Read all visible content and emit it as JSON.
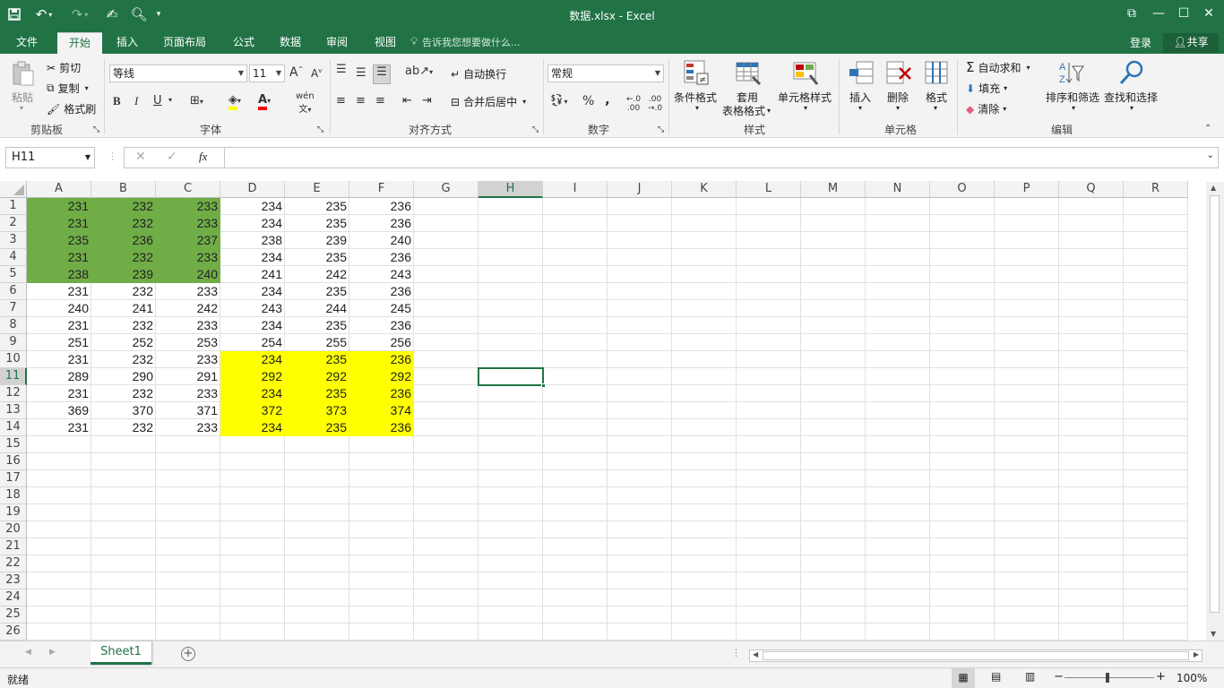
{
  "window": {
    "title": "数据.xlsx - Excel",
    "accent": "#217346"
  },
  "tabs": [
    {
      "label": "文件",
      "active": false
    },
    {
      "label": "开始",
      "active": true
    },
    {
      "label": "插入",
      "active": false
    },
    {
      "label": "页面布局",
      "active": false
    },
    {
      "label": "公式",
      "active": false
    },
    {
      "label": "数据",
      "active": false
    },
    {
      "label": "审阅",
      "active": false
    },
    {
      "label": "视图",
      "active": false
    }
  ],
  "tell_me": "告诉我您想要做什么...",
  "account": {
    "login": "登录",
    "share": "共享"
  },
  "ribbon": {
    "clipboard": {
      "paste": "粘贴",
      "cut": "剪切",
      "copy": "复制",
      "format_painter": "格式刷",
      "label": "剪贴板"
    },
    "font": {
      "name": "等线",
      "size": "11",
      "label": "字体",
      "bold": "B",
      "italic": "I",
      "underline": "U"
    },
    "alignment": {
      "wrap": "自动换行",
      "merge": "合并后居中",
      "label": "对齐方式"
    },
    "number": {
      "format": "常规",
      "label": "数字",
      "percent": "%",
      "comma": ","
    },
    "styles": {
      "conditional": "条件格式",
      "table_1": "套用",
      "table_2": "表格格式",
      "cell_styles": "单元格样式",
      "label": "样式"
    },
    "cells": {
      "insert": "插入",
      "delete": "删除",
      "format": "格式",
      "label": "单元格"
    },
    "editing": {
      "autosum": "自动求和",
      "fill": "填充",
      "clear": "清除",
      "sort": "排序和筛选",
      "find": "查找和选择",
      "label": "编辑"
    }
  },
  "formula": {
    "namebox": "H11",
    "fx": "fx",
    "content": ""
  },
  "columns": [
    "A",
    "B",
    "C",
    "D",
    "E",
    "F",
    "G",
    "H",
    "I",
    "J",
    "K",
    "L",
    "M",
    "N",
    "O",
    "P",
    "Q",
    "R"
  ],
  "rows": [
    "1",
    "2",
    "3",
    "4",
    "5",
    "6",
    "7",
    "8",
    "9",
    "10",
    "11",
    "12",
    "13",
    "14",
    "15",
    "16",
    "17",
    "18",
    "19",
    "20",
    "21",
    "22",
    "23",
    "24",
    "25",
    "26"
  ],
  "selected_col": "H",
  "selected_row": "11",
  "cells": [
    [
      "231",
      "232",
      "233",
      "234",
      "235",
      "236"
    ],
    [
      "231",
      "232",
      "233",
      "234",
      "235",
      "236"
    ],
    [
      "235",
      "236",
      "237",
      "238",
      "239",
      "240"
    ],
    [
      "231",
      "232",
      "233",
      "234",
      "235",
      "236"
    ],
    [
      "238",
      "239",
      "240",
      "241",
      "242",
      "243"
    ],
    [
      "231",
      "232",
      "233",
      "234",
      "235",
      "236"
    ],
    [
      "240",
      "241",
      "242",
      "243",
      "244",
      "245"
    ],
    [
      "231",
      "232",
      "233",
      "234",
      "235",
      "236"
    ],
    [
      "251",
      "252",
      "253",
      "254",
      "255",
      "256"
    ],
    [
      "231",
      "232",
      "233",
      "234",
      "235",
      "236"
    ],
    [
      "289",
      "290",
      "291",
      "292",
      "292",
      "292"
    ],
    [
      "231",
      "232",
      "233",
      "234",
      "235",
      "236"
    ],
    [
      "369",
      "370",
      "371",
      "372",
      "373",
      "374"
    ],
    [
      "231",
      "232",
      "233",
      "234",
      "235",
      "236"
    ]
  ],
  "highlight": {
    "green": {
      "rows": [
        1,
        5
      ],
      "cols": [
        "A",
        "C"
      ],
      "color": "#70ad47"
    },
    "yellow": {
      "rows": [
        10,
        14
      ],
      "cols": [
        "D",
        "F"
      ],
      "color": "#ffff00"
    }
  },
  "sheet": {
    "name": "Sheet1"
  },
  "status": {
    "ready": "就绪",
    "zoom": "100%"
  }
}
